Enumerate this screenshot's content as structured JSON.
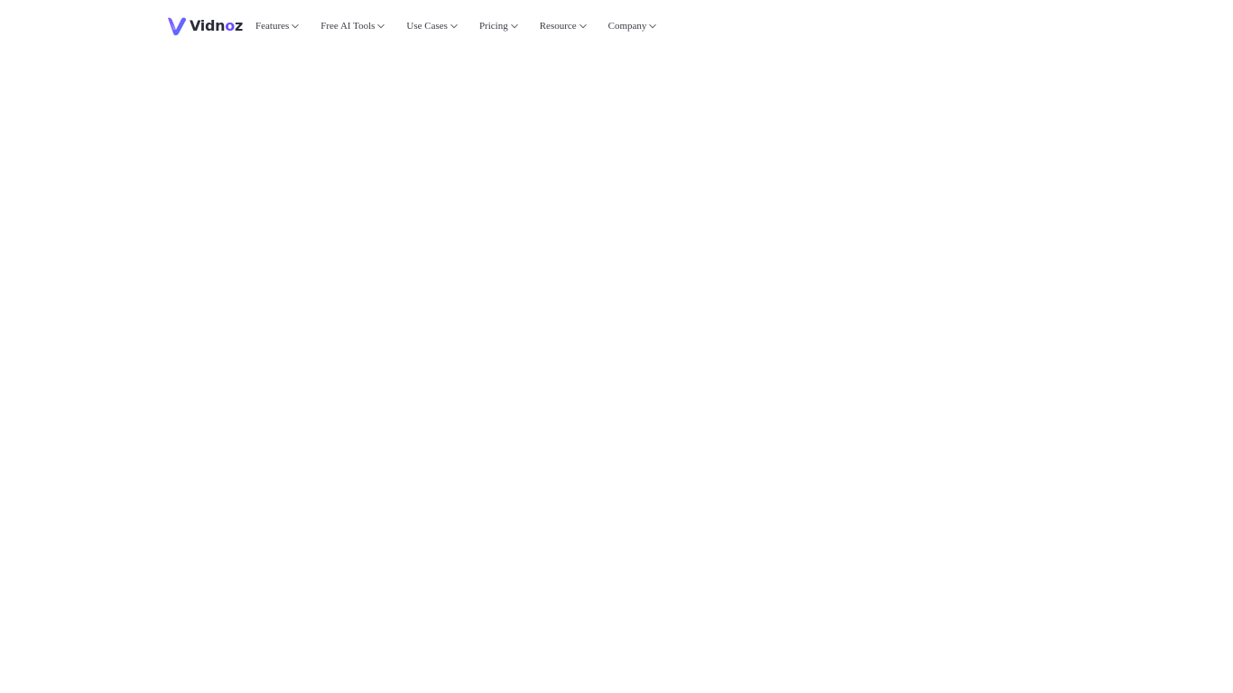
{
  "brand": {
    "name_prefix": "Vidn",
    "name_accent": "o",
    "name_suffix": "z",
    "accent_color": "#6d4bff",
    "icon": "vidnoz-logo-icon"
  },
  "nav": {
    "items": [
      {
        "label": "Features",
        "icon": "chevron-down-icon"
      },
      {
        "label": "Free AI Tools",
        "icon": "chevron-down-icon"
      },
      {
        "label": "Use Cases",
        "icon": "chevron-down-icon"
      },
      {
        "label": "Pricing",
        "icon": "chevron-down-icon"
      },
      {
        "label": "Resource",
        "icon": "chevron-down-icon"
      },
      {
        "label": "Company",
        "icon": "chevron-down-icon"
      }
    ]
  }
}
